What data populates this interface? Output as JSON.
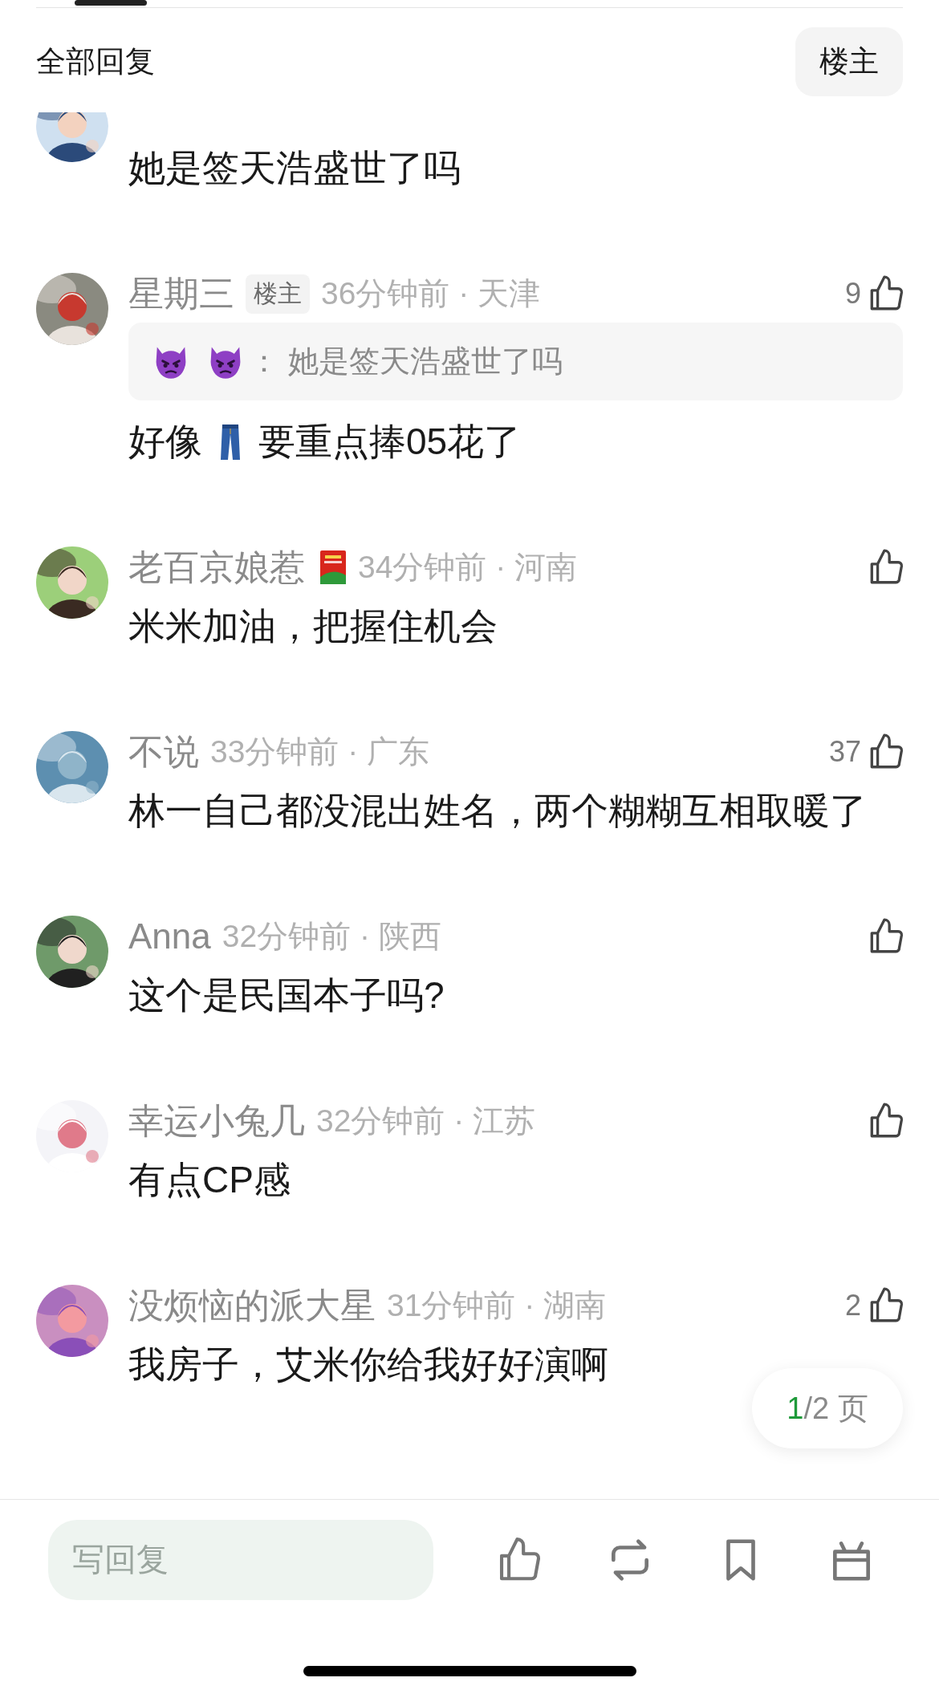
{
  "header": {
    "title": "全部回复",
    "filter_button": "楼主"
  },
  "comments": [
    {
      "cut_top": true,
      "body": [
        {
          "kind": "text",
          "text": "她是签天浩盛世了吗"
        }
      ]
    },
    {
      "user": "星期三",
      "tag": "楼主",
      "time": "36分钟前 · 天津",
      "likes": "9",
      "quote": {
        "author": [
          {
            "kind": "devil"
          },
          {
            "kind": "devil"
          }
        ],
        "colon": "：",
        "text": "她是签天浩盛世了吗"
      },
      "body": [
        {
          "kind": "text",
          "text": "好像"
        },
        {
          "kind": "jeans"
        },
        {
          "kind": "text",
          "text": "要重点捧05花了"
        }
      ]
    },
    {
      "user": "老百京娘惹",
      "badge": {
        "kind": "book"
      },
      "time": "34分钟前 · 河南",
      "body": [
        {
          "kind": "text",
          "text": "米米加油，把握住机会"
        }
      ]
    },
    {
      "user": "不说",
      "time": "33分钟前 · 广东",
      "likes": "37",
      "body": [
        {
          "kind": "text",
          "text": "林一自己都没混出姓名，两个糊糊互相取暖了"
        }
      ]
    },
    {
      "user": "Anna",
      "time": "32分钟前 · 陕西",
      "body": [
        {
          "kind": "text",
          "text": "这个是民国本子吗?"
        }
      ]
    },
    {
      "user": "幸运小兔几",
      "time": "32分钟前 · 江苏",
      "body": [
        {
          "kind": "text",
          "text": "有点CP感"
        }
      ]
    },
    {
      "user": "没烦恼的派大星",
      "time": "31分钟前 · 湖南",
      "likes": "2",
      "body": [
        {
          "kind": "text",
          "text": "我房子，艾米你给我好好演啊"
        }
      ]
    }
  ],
  "pager": {
    "current": "1",
    "rest": "/2 页"
  },
  "bottom_bar": {
    "reply_placeholder": "写回复",
    "actions": [
      {
        "kind": "like"
      },
      {
        "kind": "repost"
      },
      {
        "kind": "bookmark"
      },
      {
        "kind": "gift"
      }
    ]
  }
}
